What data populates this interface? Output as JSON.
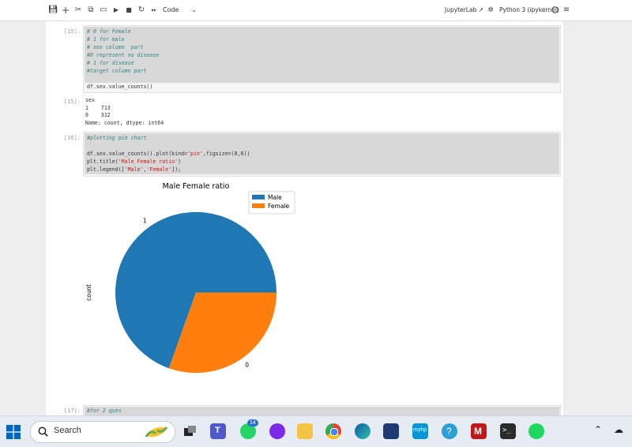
{
  "toolbar": {
    "save_icon": "save-icon",
    "add_icon": "plus-icon",
    "cut_icon": "scissors-icon",
    "copy_icon": "copy-icon",
    "paste_icon": "paste-icon",
    "run_icon": "play-icon",
    "stop_icon": "stop-icon",
    "restart_icon": "restart-icon",
    "run_all_icon": "fast-forward-icon",
    "cell_type": "Code",
    "jupyterlab_label": "JupyterLab",
    "kernel_label": "Python 3 (ipykernel)"
  },
  "cells": {
    "c15": {
      "prompt": "[15]:",
      "lines": [
        "# 0 for Female",
        "# 1 for male",
        "# sex column  part",
        "#0 represent no disease",
        "# 1 for disease",
        "#target column part",
        "",
        "df.sex.value_counts()"
      ],
      "out_prompt": "[15]:",
      "output": [
        "sex",
        "1    713",
        "0    312",
        "Name: count, dtype: int64"
      ]
    },
    "c16": {
      "prompt": "[16]:",
      "comment": "#plotting pie chart",
      "line2_a": "df.sex.value_counts().plot(kind=",
      "line2_s": "'pie'",
      "line2_b": ",figsize=(8,6))",
      "line3_a": "plt.title(",
      "line3_s": "'Male Female ratio'",
      "line3_b": ")",
      "line4_a": "plt.legend([",
      "line4_s1": "'Male'",
      "line4_c": ",",
      "line4_s2": "'Female'",
      "line4_b": "]);"
    },
    "c17": {
      "prompt": "[17]:",
      "line": "#for 2 ques"
    }
  },
  "chart_data": {
    "type": "pie",
    "title": "Male Female ratio",
    "ylabel": "count",
    "categories": [
      "1",
      "0"
    ],
    "values": [
      713,
      312
    ],
    "slice_labels": [
      "1",
      "0"
    ],
    "legend": [
      "Male",
      "Female"
    ],
    "colors": [
      "#1f77b4",
      "#ff7f0e"
    ],
    "legend_position": "upper right"
  },
  "taskbar": {
    "search_text": "Search",
    "whatsapp_badge": "14",
    "mcafee_letter": "M",
    "myhp_text": "myhp"
  }
}
